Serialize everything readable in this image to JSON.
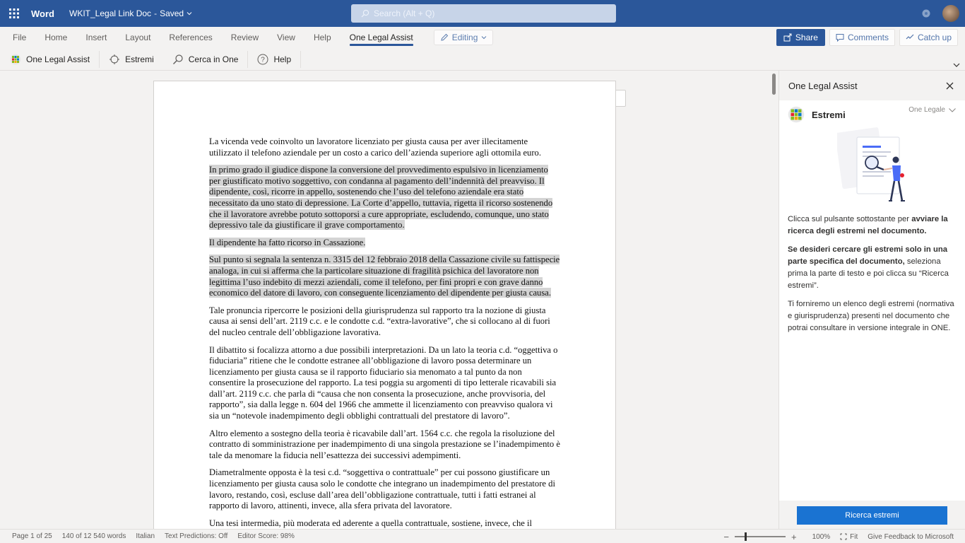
{
  "titlebar": {
    "app_name": "Word",
    "doc_name": "WKIT_Legal Link Doc",
    "separator": "-",
    "save_status": "Saved",
    "search_placeholder": "Search (Alt + Q)"
  },
  "ribbon": {
    "tabs": [
      {
        "label": "File"
      },
      {
        "label": "Home"
      },
      {
        "label": "Insert"
      },
      {
        "label": "Layout"
      },
      {
        "label": "References"
      },
      {
        "label": "Review"
      },
      {
        "label": "View"
      },
      {
        "label": "Help"
      },
      {
        "label": "One Legal Assist"
      }
    ],
    "active_tab": "One Legal Assist",
    "editing_label": "Editing",
    "share_label": "Share",
    "comments_label": "Comments",
    "catchup_label": "Catch up"
  },
  "toolbar": {
    "one_legal_assist": "One Legal Assist",
    "estremi": "Estremi",
    "cerca_in_one": "Cerca in One",
    "help": "Help"
  },
  "document": {
    "paragraphs": [
      {
        "text": "La vicenda vede coinvolto un lavoratore licenziato per giusta causa per aver illecitamente utilizzato il telefono aziendale per un costo a carico dell’azienda superiore agli ottomila euro.",
        "highlighted": false
      },
      {
        "text": "In primo grado il giudice dispone la conversione del provvedimento espulsivo in licenziamento per giustificato motivo soggettivo, con condanna al pagamento dell’indennità del preavviso. Il dipendente, così, ricorre in appello, sostenendo che l’uso del telefono aziendale era stato necessitato da uno stato di depressione. La Corte d’appello, tuttavia, rigetta il ricorso sostenendo che il lavoratore avrebbe potuto sottoporsi a cure appropriate, escludendo, comunque, uno stato depressivo tale da giustificare il grave comportamento.",
        "highlighted": true
      },
      {
        "text": "Il dipendente ha fatto ricorso in Cassazione.",
        "highlighted": true
      },
      {
        "text": "Sul punto si segnala la sentenza n. 3315 del 12 febbraio 2018 della Cassazione civile su fattispecie analoga, in cui si afferma che la particolare situazione di fragilità psichica del lavoratore non legittima l’uso indebito di mezzi aziendali, come il telefono, per fini propri e con grave danno economico del datore di lavoro, con conseguente licenziamento del dipendente per giusta causa.",
        "highlighted": true
      },
      {
        "text": "Tale pronuncia ripercorre le posizioni della giurisprudenza sul rapporto tra la nozione di giusta causa ai sensi dell’art. 2119 c.c. e le condotte c.d. “extra-lavorative”, che si collocano al di fuori del nucleo centrale dell’obbligazione lavorativa.",
        "highlighted": false
      },
      {
        "text": "Il dibattito si focalizza attorno a due possibili interpretazioni. Da un lato la teoria c.d. “oggettiva o fiduciaria” ritiene che le condotte estranee all’obbligazione di lavoro possa determinare un licenziamento per giusta causa se il rapporto fiduciario sia menomato a tal punto da non consentire la prosecuzione del rapporto. La tesi poggia su argomenti di tipo letterale ricavabili sia dall’art. 2119 c.c. che parla di “causa che non consenta la prosecuzione, anche provvisoria, del rapporto”, sia dalla legge n. 604 del 1966 che ammette il licenziamento con preavviso qualora vi sia un “notevole inadempimento degli obblighi contrattuali del prestatore di lavoro”.",
        "highlighted": false
      },
      {
        "text": "Altro elemento a sostegno della teoria è ricavabile dall’art. 1564 c.c. che regola la risoluzione del contratto di somministrazione per inadempimento di una singola prestazione se l’inadempimento è tale da menomare la fiducia nell’esattezza dei successivi adempimenti.",
        "highlighted": false
      },
      {
        "text": "Diametralmente opposta è la tesi c.d. “soggettiva o contrattuale” per cui possono giustificare un licenziamento per giusta causa solo le condotte che integrano un inadempimento del prestatore di lavoro, restando, così, escluse dall’area dell’obbligazione contrattuale, tutti i fatti estranei al rapporto di lavoro, attinenti, invece, alla sfera privata del lavoratore.",
        "highlighted": false
      },
      {
        "text": "Una tesi intermedia, più moderata ed aderente a quella contrattuale, sostiene, invece, che il",
        "highlighted": false
      }
    ]
  },
  "pane": {
    "title": "One Legal Assist",
    "section_title": "Estremi",
    "selector_label": "One Legale",
    "intro_plain": "Clicca sul pulsante sottostante per ",
    "intro_bold": "avviare la ricerca degli estremi nel documento.",
    "para2_bold": "Se desideri cercare gli estremi solo in una parte specifica del documento,",
    "para2_plain": " seleziona prima la parte di testo e poi clicca su “Ricerca estremi”.",
    "para3": "Ti forniremo un elenco degli estremi (normativa e giurisprudenza) presenti nel documento che potrai consultare in versione integrale in ONE.",
    "button_label": "Ricerca estremi",
    "accent_color": "#1a73d2"
  },
  "status": {
    "page": "Page 1 of 25",
    "words": "140 of 12 540 words",
    "language": "Italian",
    "text_predictions": "Text Predictions: Off",
    "editor_score": "Editor Score: 98%",
    "zoom_out": "−",
    "zoom_in": "+",
    "zoom": "100%",
    "fit": "Fit",
    "feedback": "Give Feedback to Microsoft"
  },
  "colors": {
    "brand_blue": "#2b579a",
    "highlight_gray": "#d4d4d4"
  }
}
